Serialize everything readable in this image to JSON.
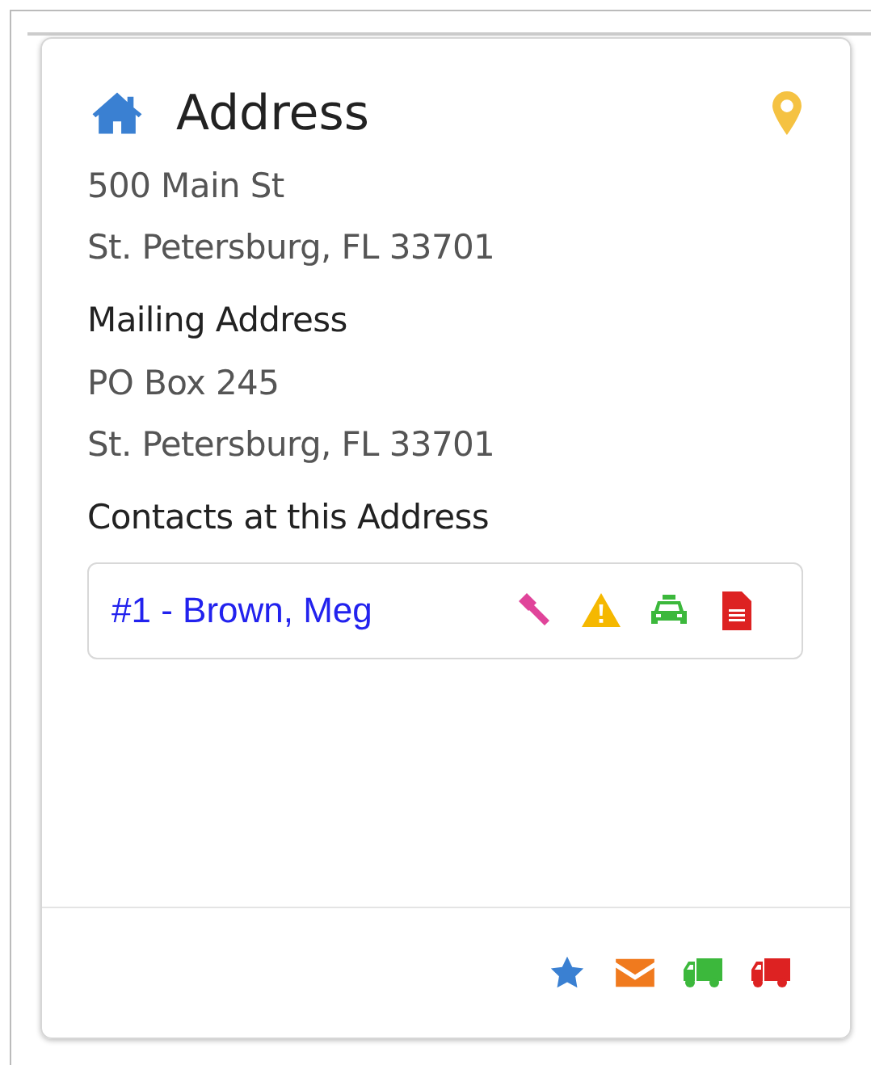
{
  "card": {
    "title": "Address",
    "address_lines": [
      "500 Main St",
      "St. Petersburg, FL 33701"
    ],
    "mailing_heading": "Mailing Address",
    "mailing_lines": [
      "PO Box 245",
      "St. Petersburg, FL 33701"
    ],
    "contacts_heading": "Contacts at this Address",
    "contacts": [
      {
        "label": "#1 - Brown, Meg",
        "icons": [
          {
            "kind": "gavel",
            "color": "#e0449a"
          },
          {
            "kind": "warning",
            "color": "#f5b800"
          },
          {
            "kind": "car",
            "color": "#3cb83c"
          },
          {
            "kind": "document",
            "color": "#dd2222"
          }
        ]
      }
    ],
    "footer_icons": [
      {
        "kind": "star",
        "color": "#3a80d2"
      },
      {
        "kind": "envelope",
        "color": "#f07a1e"
      },
      {
        "kind": "truck",
        "color": "#3cb83c"
      },
      {
        "kind": "truck",
        "color": "#dd2222"
      }
    ]
  }
}
